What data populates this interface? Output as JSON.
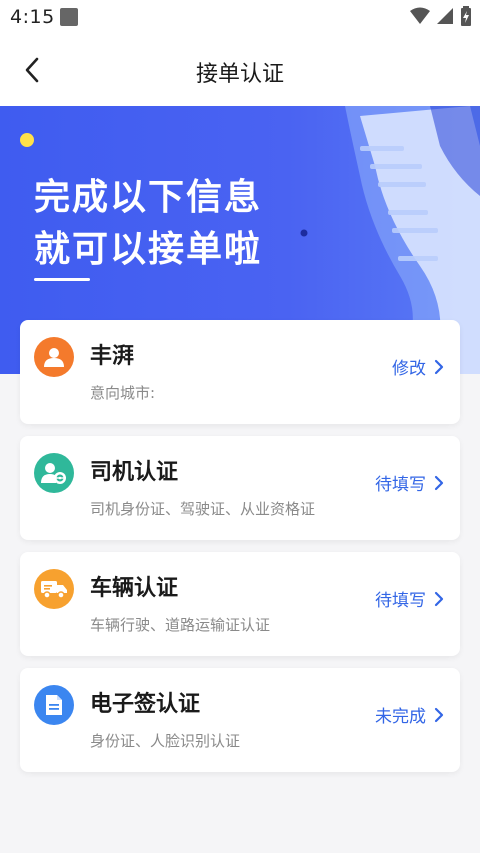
{
  "status_bar": {
    "time": "4:15",
    "icons": [
      "notification-square-icon",
      "wifi-icon",
      "signal-icon",
      "battery-icon"
    ]
  },
  "app_bar": {
    "title": "接单认证",
    "back_icon": "chevron-left-icon"
  },
  "banner": {
    "line1": "完成以下信息",
    "line2": "就可以接单啦",
    "background": "#4560f0"
  },
  "cards": [
    {
      "title": "丰湃",
      "subtitle": "意向城市:",
      "action": "修改",
      "icon": "user-icon",
      "icon_color": "#f47a2c"
    },
    {
      "title": "司机认证",
      "subtitle": "司机身份证、驾驶证、从业资格证",
      "action": "待填写",
      "icon": "driver-steering-icon",
      "icon_color": "#2fb89a"
    },
    {
      "title": "车辆认证",
      "subtitle": "车辆行驶、道路运输证认证",
      "action": "待填写",
      "icon": "truck-icon",
      "icon_color": "#f7a12f"
    },
    {
      "title": "电子签认证",
      "subtitle": "身份证、人脸识别认证",
      "action": "未完成",
      "icon": "document-icon",
      "icon_color": "#3b86f0"
    }
  ],
  "colors": {
    "accent": "#3366e6",
    "page_background": "#f5f5f7"
  }
}
